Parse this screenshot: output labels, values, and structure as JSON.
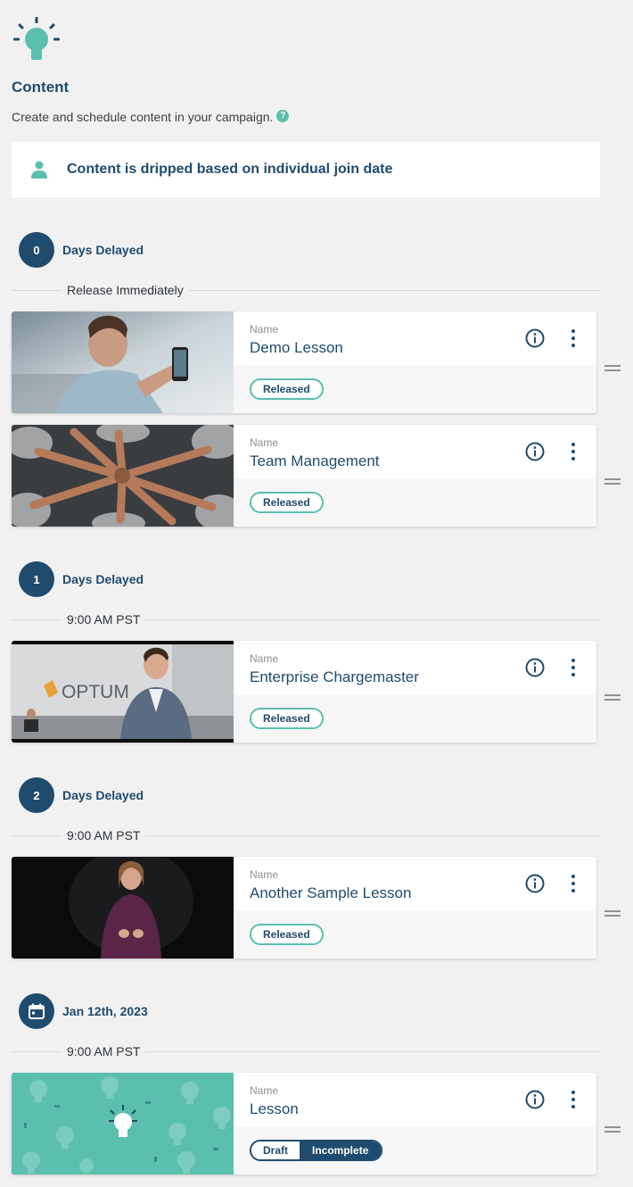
{
  "header": {
    "title": "Content",
    "subtitle": "Create and schedule content in your campaign.",
    "icon": "lightbulb-icon",
    "help_icon_glyph": "?"
  },
  "drip_banner": {
    "text": "Content is dripped based on individual join date",
    "icon": "person-icon"
  },
  "colors": {
    "brand_navy": "#1f4b6e",
    "accent_teal": "#5bbfad",
    "background": "#f1f1f2"
  },
  "groups": [
    {
      "badge": "0",
      "label": "Days Delayed",
      "release": "Release Immediately",
      "lessons": [
        {
          "name_label": "Name",
          "name": "Demo Lesson",
          "status": "Released"
        },
        {
          "name_label": "Name",
          "name": "Team Management",
          "status": "Released"
        }
      ]
    },
    {
      "badge": "1",
      "label": "Days Delayed",
      "release": "9:00 AM PST",
      "lessons": [
        {
          "name_label": "Name",
          "name": "Enterprise Chargemaster",
          "status": "Released",
          "thumb_logo": "OPTUM"
        }
      ]
    },
    {
      "badge": "2",
      "label": "Days Delayed",
      "release": "9:00 AM PST",
      "lessons": [
        {
          "name_label": "Name",
          "name": "Another Sample Lesson",
          "status": "Released"
        }
      ]
    },
    {
      "badge_icon": "calendar-icon",
      "label": "Jan 12th, 2023",
      "release": "9:00 AM PST",
      "lessons": [
        {
          "name_label": "Name",
          "name": "Lesson",
          "status_draft": "Draft",
          "status_incomplete": "Incomplete"
        }
      ]
    }
  ]
}
